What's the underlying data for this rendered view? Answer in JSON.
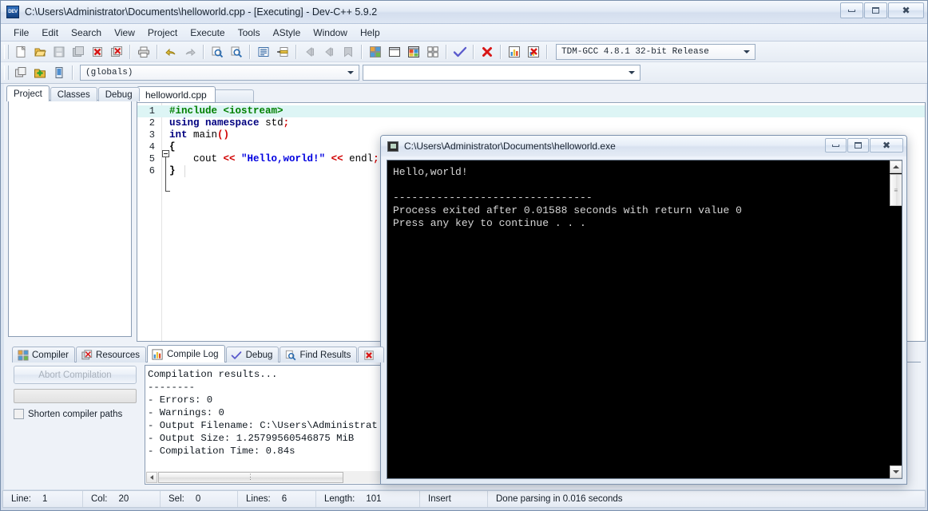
{
  "window": {
    "title": "C:\\Users\\Administrator\\Documents\\helloworld.cpp - [Executing] - Dev-C++ 5.9.2",
    "icon_label": "DEV",
    "buttons": {
      "minimize": "minimize-button",
      "maximize": "maximize-button",
      "close": "close-button"
    }
  },
  "menu": {
    "items": [
      "File",
      "Edit",
      "Search",
      "View",
      "Project",
      "Execute",
      "Tools",
      "AStyle",
      "Window",
      "Help"
    ]
  },
  "toolbar": {
    "compiler_select": "TDM-GCC 4.8.1 32-bit Release",
    "globals_select": "(globals)",
    "class_select": ""
  },
  "left_panel": {
    "tabs": [
      {
        "label": "Project",
        "active": true
      },
      {
        "label": "Classes",
        "active": false
      },
      {
        "label": "Debug",
        "active": false
      }
    ]
  },
  "editor": {
    "tabs": [
      {
        "label": "helloworld.cpp",
        "active": true
      }
    ],
    "lines": [
      {
        "num": "1",
        "current": true,
        "tokens": [
          {
            "t": "#include ",
            "c": "k-pre"
          },
          {
            "t": "<iostream>",
            "c": "k-pre"
          }
        ]
      },
      {
        "num": "2",
        "current": false,
        "tokens": [
          {
            "t": "using",
            "c": "k-kw"
          },
          {
            "t": " ",
            "c": "k-id"
          },
          {
            "t": "namespace",
            "c": "k-kw"
          },
          {
            "t": " ",
            "c": "k-id"
          },
          {
            "t": "std",
            "c": "k-id"
          },
          {
            "t": ";",
            "c": "k-pun"
          }
        ]
      },
      {
        "num": "3",
        "current": false,
        "tokens": [
          {
            "t": "int",
            "c": "k-kw"
          },
          {
            "t": " ",
            "c": "k-id"
          },
          {
            "t": "main",
            "c": "k-id"
          },
          {
            "t": "()",
            "c": "k-pun"
          }
        ]
      },
      {
        "num": "4",
        "current": false,
        "tokens": [
          {
            "t": "{",
            "c": "k-brace"
          }
        ]
      },
      {
        "num": "5",
        "current": false,
        "tokens": [
          {
            "t": "    cout ",
            "c": "k-id"
          },
          {
            "t": "<<",
            "c": "k-op"
          },
          {
            "t": " ",
            "c": "k-id"
          },
          {
            "t": "\"Hello,world!\"",
            "c": "k-str"
          },
          {
            "t": " ",
            "c": "k-id"
          },
          {
            "t": "<<",
            "c": "k-op"
          },
          {
            "t": " endl",
            "c": "k-id"
          },
          {
            "t": ";",
            "c": "k-pun"
          }
        ]
      },
      {
        "num": "6",
        "current": false,
        "tokens": [
          {
            "t": "}",
            "c": "k-brace"
          }
        ]
      }
    ]
  },
  "log_panel": {
    "tabs": [
      {
        "label": "Compiler",
        "icon": "compiler-icon",
        "active": false
      },
      {
        "label": "Resources",
        "icon": "resources-icon",
        "active": false
      },
      {
        "label": "Compile Log",
        "icon": "compile-log-icon",
        "active": true
      },
      {
        "label": "Debug",
        "icon": "debug-check-icon",
        "active": false
      },
      {
        "label": "Find Results",
        "icon": "find-results-icon",
        "active": false
      },
      {
        "label": "",
        "icon": "close-bug-icon",
        "active": false
      }
    ],
    "abort_button": "Abort Compilation",
    "shorten_checkbox_label": "Shorten compiler paths",
    "shorten_checked": false,
    "output_lines": [
      "Compilation results...",
      "--------",
      "- Errors: 0",
      "- Warnings: 0",
      "- Output Filename: C:\\Users\\Administrat",
      "- Output Size: 1.25799560546875 MiB",
      "- Compilation Time: 0.84s"
    ]
  },
  "statusbar": {
    "cells": [
      {
        "label": "Line:",
        "value": "1"
      },
      {
        "label": "Col:",
        "value": "20"
      },
      {
        "label": "Sel:",
        "value": "0"
      },
      {
        "label": "Lines:",
        "value": "6"
      },
      {
        "label": "Length:",
        "value": "101"
      }
    ],
    "mode": "Insert",
    "message": "Done parsing in 0.016 seconds"
  },
  "console": {
    "title": "C:\\Users\\Administrator\\Documents\\helloworld.exe",
    "output": "Hello,world!\n\n--------------------------------\nProcess exited after 0.01588 seconds with return value 0\nPress any key to continue . . .",
    "buttons": {
      "minimize": "minimize-button",
      "maximize": "maximize-button",
      "close": "close-button"
    }
  },
  "colors": {
    "titlebar_text": "#16212e",
    "console_bg": "#000000",
    "console_fg": "#d6d6d6",
    "current_line_highlight": "#ddf5f5",
    "string_color": "#0000e0",
    "keyword_color": "#000080",
    "preprocessor_color": "#008000",
    "operator_color": "#d00000"
  }
}
